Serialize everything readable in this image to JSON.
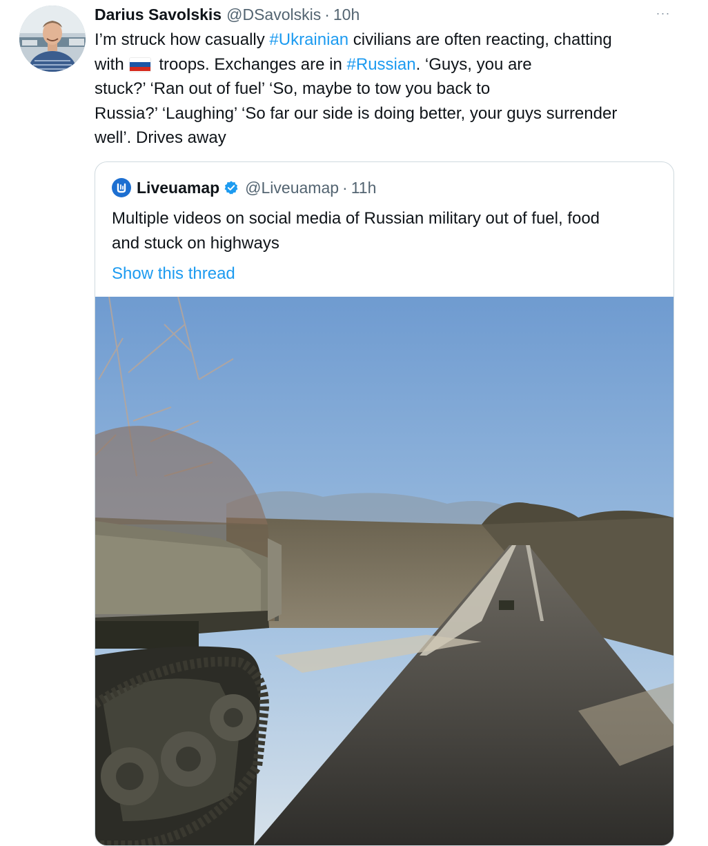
{
  "tweet": {
    "author_name": "Darius Savolskis",
    "author_handle": "@DSavolskis",
    "separator": "·",
    "time": "10h",
    "more_icon": "more-horizontal-icon",
    "lines": [
      {
        "pre": "I’m struck how casually ",
        "tag": "#Ukrainian",
        "post": " civilians are often reacting, chatting"
      },
      {
        "pre": "with",
        "flag": "russian-flag",
        "post": " troops. Exchanges are in ",
        "tag": "#Russian",
        "tail": ". ‘Guys, you are"
      },
      {
        "text": "stuck?’ ‘Ran out of fuel’ ‘So, maybe to tow you back to"
      },
      {
        "text": "Russia?’ ‘Laughing’ ‘So far our side is doing better, your guys surrender"
      },
      {
        "text": "well’. Drives away"
      }
    ]
  },
  "quote": {
    "author_name": "Liveuamap",
    "author_handle": "@Liveuamap",
    "separator": "·",
    "time": "11h",
    "lines": [
      "Multiple videos on social media of Russian military out of fuel, food",
      "and stuck on highways"
    ],
    "show_thread": "Show this thread",
    "media": "video thumbnail: armored vehicle on a rural road"
  },
  "colors": {
    "link_blue": "#1d9bf0",
    "secondary_text": "#536471",
    "primary_text": "#0f1419",
    "border": "#cfd9de",
    "verified_blue": "#1d9bf0"
  }
}
